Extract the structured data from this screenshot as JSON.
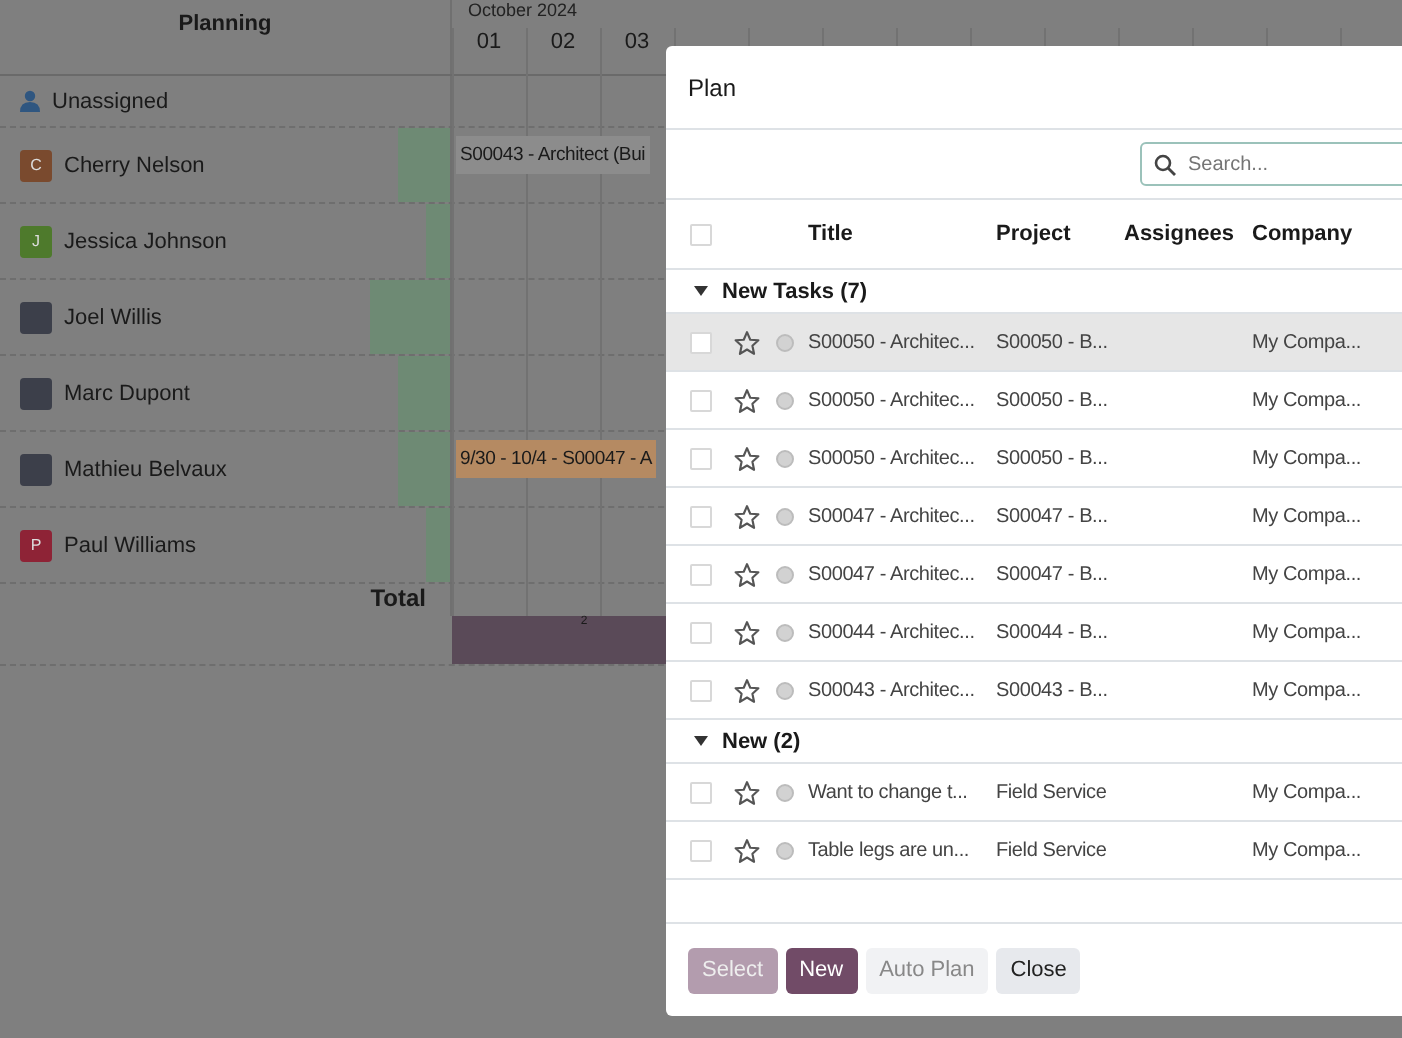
{
  "gantt": {
    "title": "Planning",
    "month": "October 2024",
    "days": [
      "01",
      "02",
      "03"
    ],
    "unassigned": "Unassigned",
    "resources": [
      {
        "name": "Cherry Nelson",
        "avatar": {
          "kind": "letter",
          "letter": "C",
          "color": "#7a4a2e"
        },
        "pill": {
          "text": "S00043 - Architect (Bui",
          "color": "#8c8c8c"
        }
      },
      {
        "name": "Jessica Johnson",
        "avatar": {
          "kind": "letter",
          "letter": "J",
          "color": "#4e7a2c"
        }
      },
      {
        "name": "Joel Willis",
        "avatar": {
          "kind": "photo"
        }
      },
      {
        "name": "Marc Dupont",
        "avatar": {
          "kind": "photo"
        }
      },
      {
        "name": "Mathieu Belvaux",
        "avatar": {
          "kind": "photo"
        },
        "pill": {
          "text": "9/30 - 10/4 - S00047 - A",
          "color": "#b58a62"
        }
      },
      {
        "name": "Paul Williams",
        "avatar": {
          "kind": "letter",
          "letter": "P",
          "color": "#8e2336"
        }
      }
    ],
    "total_label": "Total",
    "total_value": "2"
  },
  "dialog": {
    "title": "Plan",
    "search": {
      "placeholder": "Search..."
    },
    "select_all": {
      "checked": false
    },
    "columns": [
      "Title",
      "Project",
      "Assignees",
      "Company"
    ],
    "groups": [
      {
        "label": "New Tasks (7)",
        "expanded": true,
        "rows": [
          {
            "title": "S00050 - Architec...",
            "project": "S00050 - B...",
            "company": "My Compa...",
            "hovered": true
          },
          {
            "title": "S00050 - Architec...",
            "project": "S00050 - B...",
            "company": "My Compa...",
            "hovered": false
          },
          {
            "title": "S00050 - Architec...",
            "project": "S00050 - B...",
            "company": "My Compa...",
            "hovered": false
          },
          {
            "title": "S00047 - Architec...",
            "project": "S00047 - B...",
            "company": "My Compa...",
            "hovered": false
          },
          {
            "title": "S00047 - Architec...",
            "project": "S00047 - B...",
            "company": "My Compa...",
            "hovered": false
          },
          {
            "title": "S00044 - Architec...",
            "project": "S00044 - B...",
            "company": "My Compa...",
            "hovered": false
          },
          {
            "title": "S00043 - Architec...",
            "project": "S00043 - B...",
            "company": "My Compa...",
            "hovered": false
          }
        ]
      },
      {
        "label": "New (2)",
        "expanded": true,
        "rows": [
          {
            "title": "Want to change t...",
            "project": "Field Service",
            "company": "My Compa...",
            "hovered": false
          },
          {
            "title": "Table legs are un...",
            "project": "Field Service",
            "company": "My Compa...",
            "hovered": false
          }
        ]
      }
    ],
    "buttons": [
      {
        "label": "Select",
        "kind": "primary",
        "disabled": true
      },
      {
        "label": "New",
        "kind": "primary",
        "disabled": false
      },
      {
        "label": "Auto Plan",
        "kind": "secondary",
        "disabled": true
      },
      {
        "label": "Close",
        "kind": "secondary",
        "disabled": false
      }
    ]
  }
}
